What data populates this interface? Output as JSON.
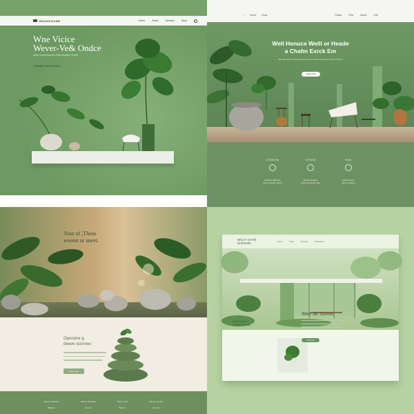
{
  "quad1": {
    "logo": "BRANDNAME",
    "nav_links": [
      "Home",
      "About",
      "Services",
      "Shop"
    ],
    "hero_title_line1": "Wne Vicice",
    "hero_title_line2": "Wever-Ve& Ondce",
    "hero_subtitle": "Wove Dook Oomine Plap Borstee Yoreto",
    "hero_cta": "Cteunibet Stor Woedbore",
    "colors": {
      "background": "#76a36a",
      "nav": "#f4f6f1",
      "shelf": "#ecefe6"
    }
  },
  "quad2": {
    "nav_left": [
      "Home",
      "Shop"
    ],
    "nav_right": [
      "Plants",
      "Pots",
      "About",
      "Cart"
    ],
    "hero_title_line1": "Well Henuce Welll or Heade",
    "hero_title_line2": "a Chafm Exrck Em",
    "hero_subtitle": "Wonduc alanuce Woonuse eonc es is tones comh atoma oum Voudrs",
    "hero_button": "Learn more",
    "features": [
      {
        "label": "COSNOON",
        "icon": "leaf-icon",
        "text1": "Wonlloo Sabonce",
        "text2": "Sonor estrwer earbo"
      },
      {
        "label": "STRANS",
        "icon": "plant-icon",
        "text1": "Wonzc Cnaolinr",
        "text2": "Sonor dimsmier dow"
      },
      {
        "label": "PASS",
        "icon": "drop-icon",
        "text1": "Wiote Boors",
        "text2": "Sonon carbioh"
      }
    ],
    "colors": {
      "wall": "#6d9a63",
      "floor": "#c9b69a",
      "features": "#6e9164"
    }
  },
  "quad3": {
    "hero_title_line1": "Your of ,Theas",
    "hero_title_line2": "woonn or aneet.",
    "section_title_line1": "Oponone g",
    "section_title_line2": "deeve sconnec",
    "cta": "Learn more",
    "footer_cols": [
      {
        "title": "Wrows Camsorde",
        "sub": "Bossom"
      },
      {
        "title": "Worwus Sounbee",
        "sub": "Cnvecos"
      },
      {
        "title": "Wohr oumet",
        "sub": "Bossom"
      },
      {
        "title": "Wecnur Sonbee",
        "sub": "Cnuoroe"
      }
    ],
    "colors": {
      "content": "#f1eee4",
      "footer": "#6f8f5e",
      "button": "#93aa86"
    }
  },
  "quad4": {
    "brand_line1": "WILIT HATE",
    "brand_line2": "SIOONN",
    "nav_links": [
      "Home",
      "Shop",
      "Sunsets",
      "Colleotions"
    ],
    "left_title_line1": "Angel Roosteo",
    "left_title_line2": "Wheoe Conaeels",
    "right_title": "Wee de Somes",
    "right_button": "Shop now",
    "colors": {
      "background": "#b7d3a2",
      "card": "#f4f8ef",
      "button": "#6e9564"
    }
  }
}
